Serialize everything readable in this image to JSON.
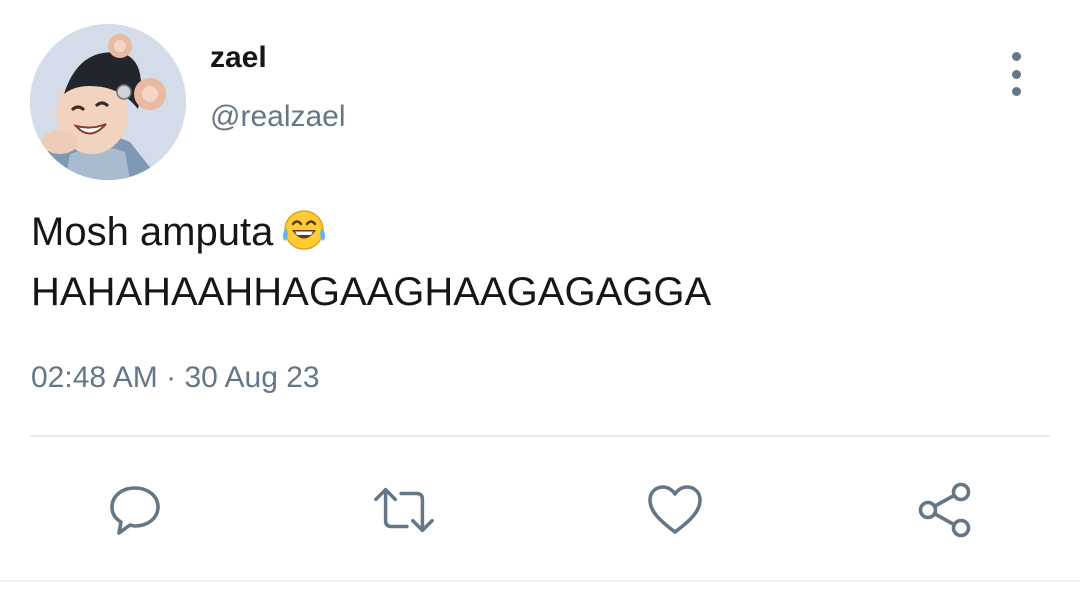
{
  "tweet": {
    "display_name": "zael",
    "handle": "@realzael",
    "text_line1": "Mosh amputa",
    "text_line2": "HAHAHAAHHAGAAGHAAGAGAGGA",
    "emoji": "face-with-tears-of-joy",
    "time": "02:48 AM",
    "separator": "·",
    "date": "30 Aug 23"
  },
  "actions": {
    "reply_icon": "comment-icon",
    "retweet_icon": "retweet-icon",
    "like_icon": "heart-icon",
    "share_icon": "share-icon"
  },
  "colors": {
    "primary_text": "#14171a",
    "secondary_text": "#657786",
    "divider": "#e6ecf0"
  }
}
